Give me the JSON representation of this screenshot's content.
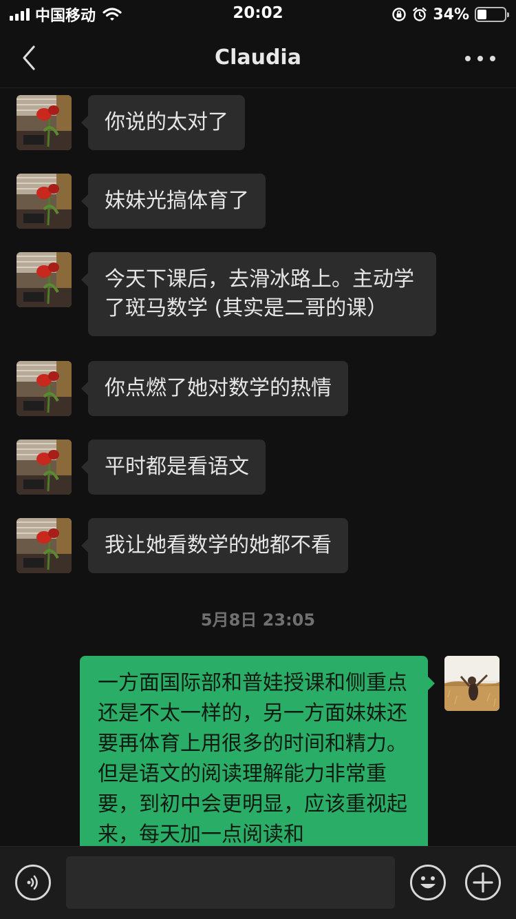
{
  "status_bar": {
    "carrier": "中国移动",
    "time": "20:02",
    "battery_percent": "34%",
    "battery_level": 0.34,
    "icons": [
      "signal-icon",
      "wifi-icon",
      "orientation-lock-icon",
      "alarm-icon",
      "battery-icon"
    ]
  },
  "nav": {
    "title": "Claudia",
    "back_icon": "chevron-left-icon",
    "more_icon": "more-dots-icon"
  },
  "messages": [
    {
      "from": "contact",
      "text": "你说的太对了"
    },
    {
      "from": "contact",
      "text": "妹妹光搞体育了"
    },
    {
      "from": "contact",
      "text": "今天下课后，去滑冰路上。主动学了斑马数学 (其实是二哥的课）"
    },
    {
      "from": "contact",
      "text": "你点燃了她对数学的热情"
    },
    {
      "from": "contact",
      "text": "平时都是看语文"
    },
    {
      "from": "contact",
      "text": "我让她看数学的她都不看"
    }
  ],
  "timestamp": "5月8日 23:05",
  "outgoing": {
    "text": "一方面国际部和普娃授课和侧重点还是不太一样的，另一方面妹妹还要再体育上用很多的时间和精力。但是语文的阅读理解能力非常重要，到初中会更明显，应该重视起来，每天加一点阅读和"
  },
  "input_bar": {
    "value": "",
    "icons": [
      "voice-icon",
      "emoji-icon",
      "plus-icon"
    ]
  },
  "colors": {
    "background": "#111111",
    "incoming_bubble": "#2c2c2c",
    "outgoing_bubble": "#2aae67",
    "input_bar": "#1c1c1c"
  }
}
